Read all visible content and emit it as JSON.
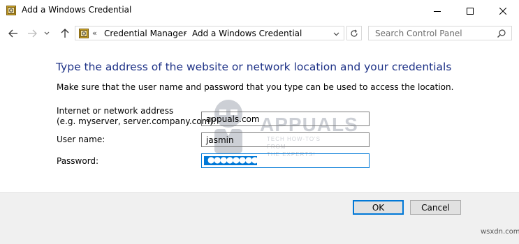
{
  "window": {
    "title": "Add a Windows Credential"
  },
  "nav": {
    "crumb_chevron": "«",
    "crumbs": [
      "Credential Manager",
      "Add a Windows Credential"
    ],
    "crumb_separator": "›",
    "search_placeholder": "Search Control Panel"
  },
  "content": {
    "heading": "Type the address of the website or network location and your credentials",
    "subtext": "Make sure that the user name and password that you type can be used to access the location.",
    "address_label_line1": "Internet or network address",
    "address_label_line2": "(e.g. myserver, server.company.com):",
    "address_value": "appuals.com",
    "username_label": "User name:",
    "username_value": "jasmin",
    "password_label": "Password:",
    "password_value": "●●●●●●●●●●●"
  },
  "watermark": {
    "brand": "APPUALS",
    "tagline_1": "TECH HOW-TO'S FROM",
    "tagline_2": "THE EXPERTS!"
  },
  "footer": {
    "ok_label": "OK",
    "cancel_label": "Cancel",
    "site_mark": "wsxdn.com"
  },
  "colors": {
    "heading": "#1e3287",
    "accent": "#0078d7",
    "footer_bg": "#f0f0f0"
  },
  "icons": [
    "credential-manager-icon",
    "minimize-icon",
    "maximize-icon",
    "close-icon",
    "back-arrow-icon",
    "forward-arrow-icon",
    "recent-dropdown-icon",
    "up-arrow-icon",
    "chevron-down-icon",
    "refresh-icon",
    "search-icon"
  ]
}
